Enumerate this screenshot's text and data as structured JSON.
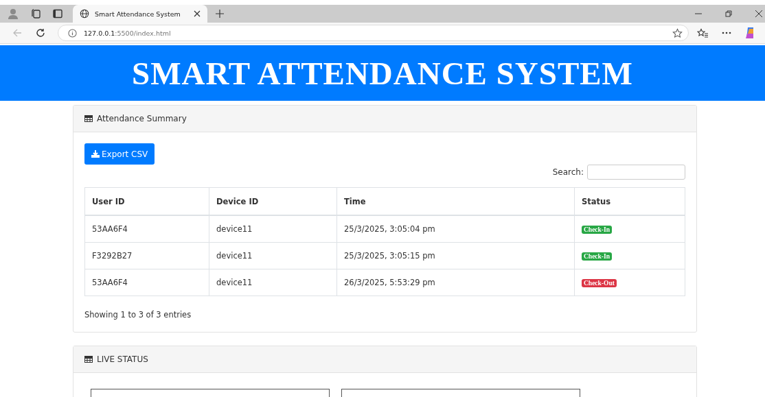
{
  "browser": {
    "tab_title": "Smart Attendance System",
    "url_host": "127.0.0.1",
    "url_rest": ":5500/index.html"
  },
  "header": {
    "title": "SMART ATTENDANCE SYSTEM"
  },
  "summary": {
    "title": "Attendance Summary",
    "export_label": "Export CSV",
    "search_label": "Search:",
    "columns": [
      "User ID",
      "Device ID",
      "Time",
      "Status"
    ],
    "rows": [
      {
        "user_id": "53AA6F4",
        "device_id": "device11",
        "time": "25/3/2025, 3:05:04 pm",
        "status": "Check-In",
        "kind": "in"
      },
      {
        "user_id": "F3292B27",
        "device_id": "device11",
        "time": "25/3/2025, 3:05:15 pm",
        "status": "Check-In",
        "kind": "in"
      },
      {
        "user_id": "53AA6F4",
        "device_id": "device11",
        "time": "26/3/2025, 5:53:29 pm",
        "status": "Check-Out",
        "kind": "out"
      }
    ],
    "info": "Showing 1 to 3 of 3 entries"
  },
  "live": {
    "title": "LIVE STATUS"
  }
}
